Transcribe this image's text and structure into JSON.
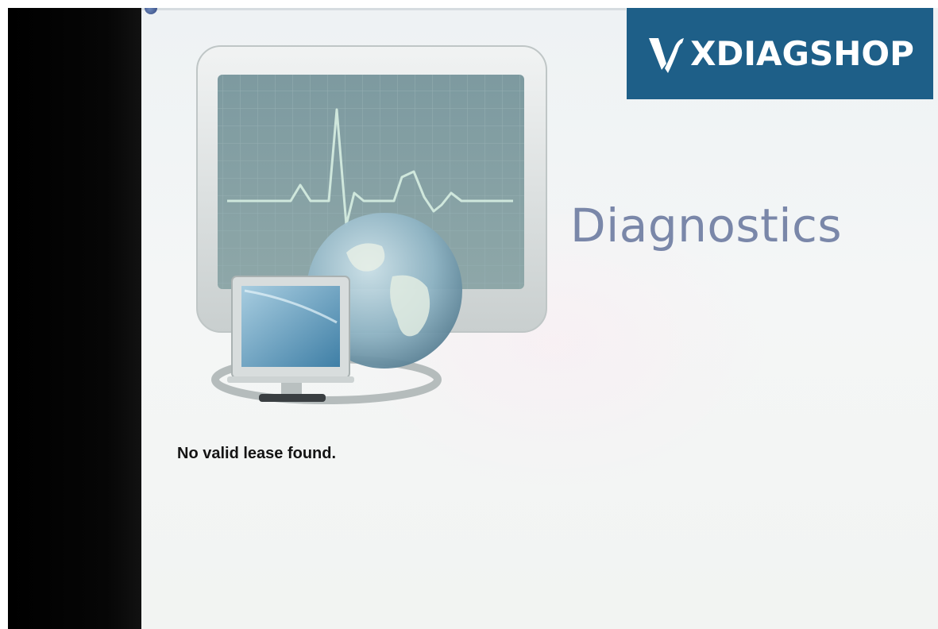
{
  "app": {
    "title": "Diagnostics"
  },
  "status": {
    "message": "No valid lease found."
  },
  "watermark": {
    "text": "XDIAGSHOP",
    "background": "#1e5f88"
  },
  "theme": {
    "title_color": "#7a87a9",
    "message_color": "#141414"
  },
  "icons": {
    "hero": "diagnostics-monitor-globe-icon",
    "corner": "app-icon"
  }
}
